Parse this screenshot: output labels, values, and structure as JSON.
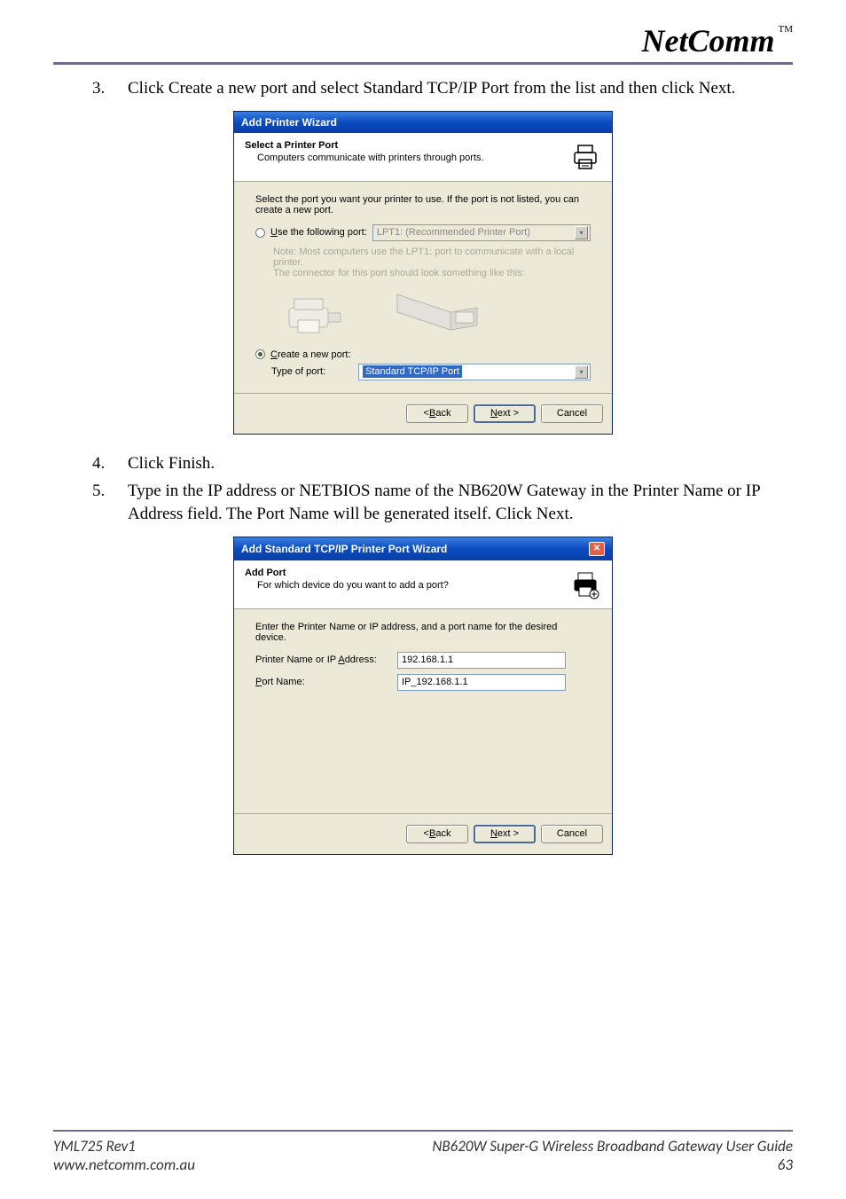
{
  "header": {
    "logo": "NetComm",
    "tm": "TM"
  },
  "steps": [
    {
      "num": "3.",
      "text": "Click Create a new port and select Standard TCP/IP Port from the list and then click Next."
    },
    {
      "num": "4.",
      "text": "Click Finish."
    },
    {
      "num": "5.",
      "text": "Type in the IP address or NETBIOS name of the NB620W Gateway in the Printer Name or IP Address field.  The Port Name will be generated itself.  Click Next."
    }
  ],
  "dialog1": {
    "title": "Add Printer Wizard",
    "banner_title": "Select a Printer Port",
    "banner_sub": "Computers communicate with printers through ports.",
    "intro": "Select the port you want your printer to use.  If the port is not listed, you can create a new port.",
    "opt_use_label_pre": "U",
    "opt_use_label_rest": "se the following port:",
    "opt_use_value": "LPT1: (Recommended Printer Port)",
    "note1": "Note: Most computers use the LPT1: port to communicate with a local printer.",
    "note2": "The connector for this port should look something like this:",
    "opt_create_label_pre": "C",
    "opt_create_label_rest": "reate a new port:",
    "type_of_port_label": "Type of port:",
    "type_of_port_value": "Standard TCP/IP Port",
    "buttons": {
      "back_pre": "< ",
      "back_u": "B",
      "back_rest": "ack",
      "next_u": "N",
      "next_rest": "ext >",
      "cancel": "Cancel"
    }
  },
  "dialog2": {
    "title": "Add Standard TCP/IP Printer Port Wizard",
    "banner_title": "Add Port",
    "banner_sub": "For which device do you want to add a port?",
    "intro": "Enter the Printer Name or IP address, and a port name for the desired device.",
    "addr_label_pre": "Printer Name or IP ",
    "addr_label_u": "A",
    "addr_label_rest": "ddress:",
    "addr_value": "192.168.1.1",
    "port_label_u": "P",
    "port_label_rest": "ort Name:",
    "port_value": "IP_192.168.1.1",
    "buttons": {
      "back_pre": "< ",
      "back_u": "B",
      "back_rest": "ack",
      "next_u": "N",
      "next_rest": "ext >",
      "cancel": "Cancel"
    }
  },
  "footer": {
    "left1": "YML725 Rev1",
    "left2": "www.netcomm.com.au",
    "right1": "NB620W Super-G Wireless Broadband  Gateway User Guide",
    "right2": "63"
  }
}
